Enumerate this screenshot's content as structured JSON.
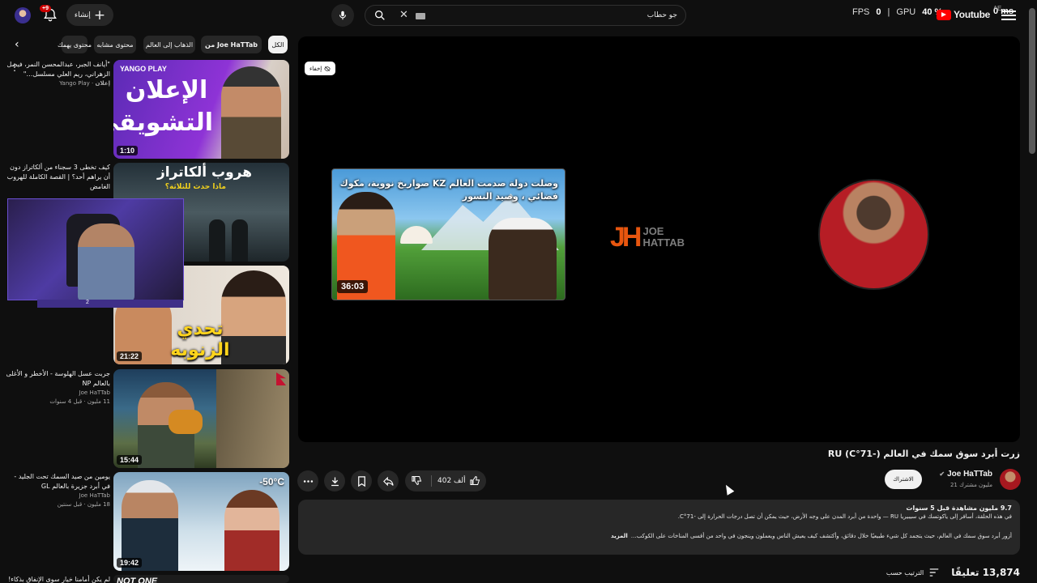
{
  "header": {
    "logo_text": "Youtube",
    "country_code": "AE",
    "search_placeholder": "",
    "search_value": "جو حطاب",
    "create_label": "إنشاء",
    "create_plus": "+",
    "notifications_badge": "+9",
    "perf": {
      "fps_label": "FPS",
      "fps_value": "0",
      "gpu_label": "GPU",
      "gpu_value": "40 %",
      "ms_label": "0 ms"
    }
  },
  "chips": {
    "items": [
      {
        "label": "الكل",
        "active": true
      },
      {
        "label": "من Joe HaTTab",
        "active": false
      },
      {
        "label": "الذهاب إلى العالم",
        "active": false
      },
      {
        "label": "محتوى مشابه",
        "active": false
      },
      {
        "label": "محتوى يهمك",
        "active": false
      }
    ]
  },
  "recommendations": [
    {
      "title": "\"أيانف الجبر، عبدالمحسن النمر، فيصل الزهراني، ريم العلي مسلسل…\"",
      "channel": "Yango Play",
      "badge": "إعلان",
      "stats": "",
      "duration": "1:10",
      "thumb_logo": "YANGO PLAY",
      "thumb_text": "الإعلان التشويقي"
    },
    {
      "title": "كيف تخطى 3 سجناء من ألكاتراز دون أن يراهم أحد؟ | القصة الكاملة للهروب الغامض",
      "channel": "",
      "badge": "",
      "stats": "",
      "duration": "",
      "thumb_text_1": "هروب ألكاتراز",
      "thumb_text_2": "ماذا حدث للثلاثة؟"
    },
    {
      "title": "",
      "channel": "",
      "badge": "",
      "stats": "",
      "duration": "21:22",
      "thumb_text": "تحدي الزنوبه"
    },
    {
      "title": "جربت عسل الهلوسة - الأخطر و الأغلى بالعالم NP",
      "channel": "Joe HaTTab",
      "badge": "",
      "stats": "11 مليون · قبل 4 سنوات",
      "duration": "15:44"
    },
    {
      "title": "يومين من صيد السمك تحت الجليد - في أبرد جزيرة بالعالم GL",
      "channel": "Joe HaTTab",
      "badge": "",
      "stats": "18 مليون · قبل سنتين",
      "duration": "19:42",
      "thumb_text": "-50°C"
    },
    {
      "title": "لم يكن أمامنا خيار سوى الإنفاق بذكاء!",
      "channel": "",
      "badge": "",
      "stats": "",
      "duration": "",
      "thumb_text": "NOT ONE"
    }
  ],
  "webcam": {
    "bar_text": "2"
  },
  "player": {
    "hide_label": "إخفاء",
    "end_card_title": "وصلت دولة صدمت العالم KZ صواريخ نووية، مكوك فضائي ، وصيد النسور",
    "end_card_duration": "36:03",
    "brand_initials": "JH",
    "brand_name_1": "JOE",
    "brand_name_2": "HATTAB"
  },
  "video": {
    "title": "زرت أبرد سوق سمك في العالم (-71°C) RU",
    "channel_name": "Joe HaTTab",
    "subscribers": "21 مليون مشترك",
    "subscribe_label": "الاشتراك",
    "likes": "402 ألف",
    "description": {
      "stats": "9.7 مليون مشاهدة  قبل 5 سنوات",
      "line1": "في هذه الحلقة، أسافر إلى ياكوتسك في سيبيريا RU — واحدة من أبرد المدن على وجه الأرض، حيث يمكن أن تصل درجات الحرارة إلى -71°C.",
      "line2": "أزور أبرد سوق سمك في العالم، حيث يتجمد كل شيء طبيعيًا خلال دقائق، وأكتشف كيف يعيش الناس ويعملون وينجون في واحد من أقسى المناخات على الكوكب…",
      "more": "المزيد"
    },
    "comments_count": "13,874 تعليقًا",
    "sort_label": "الترتيب حسب"
  }
}
